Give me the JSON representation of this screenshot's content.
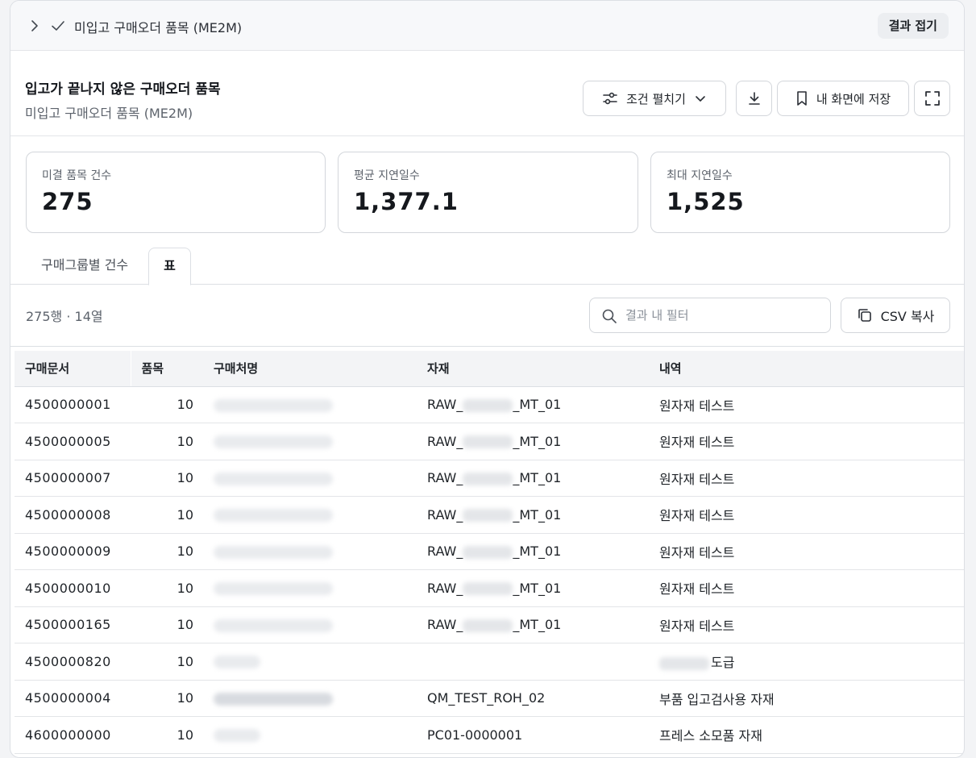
{
  "topbar": {
    "title": "미입고 구매오더 품목 (ME2M)",
    "collapse_label": "결과 접기"
  },
  "header": {
    "title": "입고가 끝나지 않은 구매오더 품목",
    "subtitle": "미입고 구매오더 품목 (ME2M)",
    "expand_label": "조건 펼치기",
    "save_label": "내 화면에 저장"
  },
  "kpis": [
    {
      "label": "미결 품목 건수",
      "value": "275"
    },
    {
      "label": "평균 지연일수",
      "value": "1,377.1"
    },
    {
      "label": "최대 지연일수",
      "value": "1,525"
    }
  ],
  "tabs": [
    {
      "label": "구매그룹별 건수",
      "active": false
    },
    {
      "label": "표",
      "active": true
    }
  ],
  "results": {
    "row_count": "275행 · 14열",
    "filter_placeholder": "결과 내 필터",
    "csv_label": "CSV 복사"
  },
  "table": {
    "columns": [
      "구매문서",
      "품목",
      "구매처명",
      "자재",
      "내역"
    ],
    "rows": [
      {
        "doc": "4500000001",
        "item": "10",
        "mat_pre": "RAW_",
        "mat_post": "_MT_01",
        "desc_pre": "",
        "desc": "원자재 테스트"
      },
      {
        "doc": "4500000005",
        "item": "10",
        "mat_pre": "RAW_",
        "mat_post": "_MT_01",
        "desc_pre": "",
        "desc": "원자재 테스트"
      },
      {
        "doc": "4500000007",
        "item": "10",
        "mat_pre": "RAW_",
        "mat_post": "_MT_01",
        "desc_pre": "",
        "desc": "원자재 테스트"
      },
      {
        "doc": "4500000008",
        "item": "10",
        "mat_pre": "RAW_",
        "mat_post": "_MT_01",
        "desc_pre": "",
        "desc": "원자재 테스트"
      },
      {
        "doc": "4500000009",
        "item": "10",
        "mat_pre": "RAW_",
        "mat_post": "_MT_01",
        "desc_pre": "",
        "desc": "원자재 테스트"
      },
      {
        "doc": "4500000010",
        "item": "10",
        "mat_pre": "RAW_",
        "mat_post": "_MT_01",
        "desc_pre": "",
        "desc": "원자재 테스트"
      },
      {
        "doc": "4500000165",
        "item": "10",
        "mat_pre": "RAW_",
        "mat_post": "_MT_01",
        "desc_pre": "",
        "desc": "원자재 테스트"
      },
      {
        "doc": "4500000820",
        "item": "10",
        "mat_pre": "",
        "mat_post": "",
        "desc_pre": "blur",
        "desc": "도급"
      },
      {
        "doc": "4500000004",
        "item": "10",
        "mat_pre": "QM_TEST_ROH_02",
        "mat_post": "",
        "desc_pre": "",
        "desc": "부품 입고검사용 자재"
      },
      {
        "doc": "4600000000",
        "item": "10",
        "mat_pre": "PC01-0000001",
        "mat_post": "",
        "desc_pre": "",
        "desc": "프레스 소모품 자재"
      }
    ]
  }
}
